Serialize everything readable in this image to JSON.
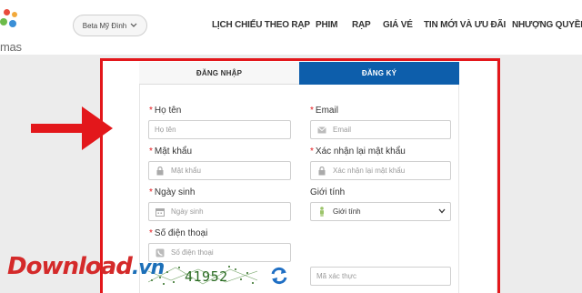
{
  "logo": {
    "text": "mas"
  },
  "cinema_selector": {
    "value": "Beta Mỹ Đình",
    "icon": "chevron-down-icon"
  },
  "nav": {
    "items": [
      "LỊCH CHIẾU THEO RẠP",
      "PHIM",
      "RẠP",
      "GIÁ VÉ",
      "TIN MỚI VÀ ƯU ĐÃI",
      "NHƯỢNG QUYỀN"
    ]
  },
  "tabs": {
    "login": "ĐĂNG NHẬP",
    "register": "ĐĂNG KÝ"
  },
  "form": {
    "required_mark": "*",
    "fullname": {
      "label": "Họ tên",
      "placeholder": "Họ tên"
    },
    "email": {
      "label": "Email",
      "placeholder": "Email"
    },
    "password": {
      "label": "Mật khẩu",
      "placeholder": "Mật khẩu"
    },
    "confirm_password": {
      "label": "Xác nhận lại mật khẩu",
      "placeholder": "Xác nhận lại mật khẩu"
    },
    "birthday": {
      "label": "Ngày sinh",
      "placeholder": "Ngày sinh"
    },
    "gender": {
      "label": "Giới tính",
      "value": "Giới tính"
    },
    "phone": {
      "label": "Số điện thoại",
      "placeholder": "Số điện thoại"
    },
    "captcha": {
      "code": "41952",
      "placeholder": "Mã xác thực"
    }
  },
  "watermark": {
    "main": "Download",
    "suffix": ".vn"
  },
  "colors": {
    "accent": "#0d5eab",
    "highlight": "#e3171b",
    "required": "#e3171b"
  }
}
